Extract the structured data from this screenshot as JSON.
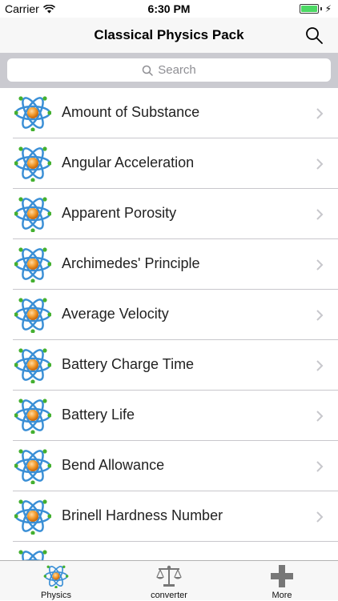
{
  "status_bar": {
    "carrier": "Carrier",
    "time": "6:30 PM"
  },
  "nav": {
    "title": "Classical Physics Pack"
  },
  "search": {
    "placeholder": "Search"
  },
  "list": {
    "items": [
      {
        "label": "Amount of Substance"
      },
      {
        "label": "Angular Acceleration"
      },
      {
        "label": "Apparent Porosity"
      },
      {
        "label": "Archimedes' Principle"
      },
      {
        "label": "Average Velocity"
      },
      {
        "label": "Battery Charge Time"
      },
      {
        "label": "Battery Life"
      },
      {
        "label": "Bend Allowance"
      },
      {
        "label": "Brinell Hardness Number"
      }
    ]
  },
  "tab_bar": {
    "tabs": [
      {
        "label": "Physics",
        "icon": "atom-icon",
        "selected": true
      },
      {
        "label": "converter",
        "icon": "scale-icon",
        "selected": false
      },
      {
        "label": "More",
        "icon": "plus-icon",
        "selected": false
      }
    ]
  },
  "colors": {
    "nav_bg": "#f7f7f7",
    "search_bg": "#cacad0",
    "battery": "#4cd964",
    "atom_orbit": "#3a8fd6",
    "atom_core": "#f39a2b"
  }
}
